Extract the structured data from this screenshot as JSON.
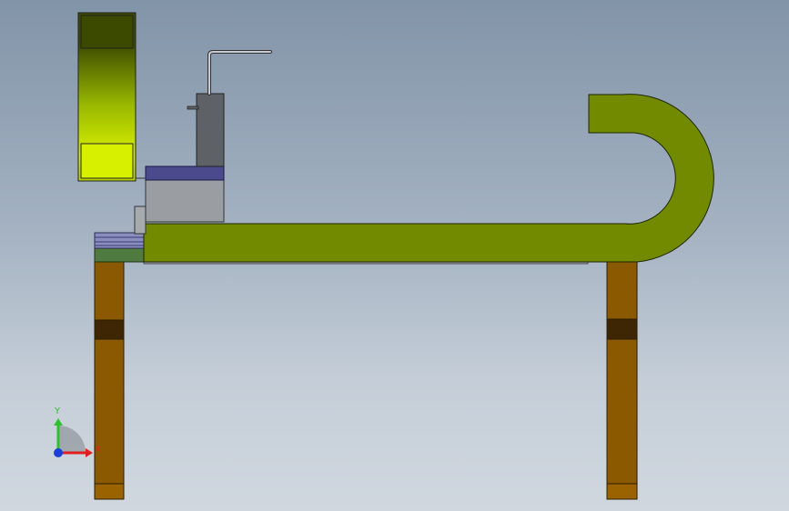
{
  "viewport": {
    "background_top": "#8294a8",
    "background_bottom": "#d0d7df"
  },
  "model": {
    "parts": [
      {
        "name": "left-leg",
        "color": "#8b5a00"
      },
      {
        "name": "right-leg",
        "color": "#8b5a00"
      },
      {
        "name": "leg-band",
        "color": "#3e2605"
      },
      {
        "name": "top-plate",
        "color": "#4f7a40"
      },
      {
        "name": "rail-base",
        "color": "#8a8ebe"
      },
      {
        "name": "cable-chain",
        "color": "#718a00"
      },
      {
        "name": "motor-block",
        "color": "#9a9ea2"
      },
      {
        "name": "motor-flange",
        "color": "#4a4a8c"
      },
      {
        "name": "spindle",
        "color": "#5e6266"
      },
      {
        "name": "control-box",
        "color": "#d6f000"
      }
    ]
  },
  "triad": {
    "y_label": "Y",
    "x_label": "X",
    "y_color": "#2ec02e",
    "x_color": "#e02020",
    "z_color": "#1a3fd8"
  }
}
